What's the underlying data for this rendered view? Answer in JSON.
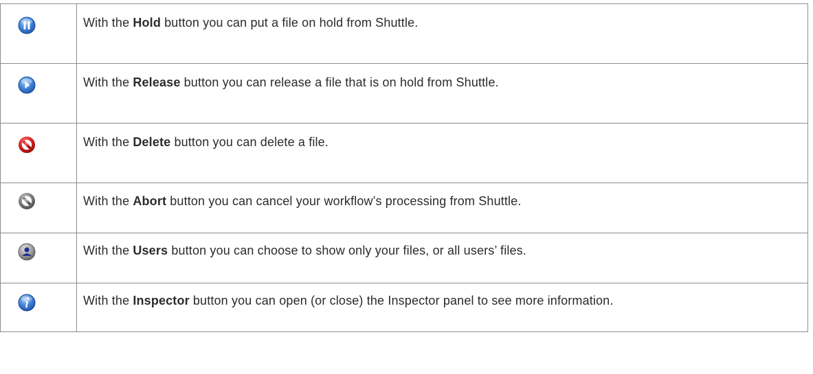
{
  "rows": [
    {
      "icon": "pause-icon",
      "prefix": "With the ",
      "keyword": "Hold",
      "suffix": " button you can put a file on hold from Shuttle."
    },
    {
      "icon": "play-icon",
      "prefix": "With the ",
      "keyword": "Release",
      "suffix": " button you can release a file that is on hold from Shuttle."
    },
    {
      "icon": "delete-no-entry-icon",
      "prefix": "With the ",
      "keyword": "Delete",
      "suffix": " button you can delete a file."
    },
    {
      "icon": "abort-no-entry-icon",
      "prefix": "With the ",
      "keyword": "Abort",
      "suffix": " button you can cancel your workflow’s processing from Shuttle."
    },
    {
      "icon": "users-icon",
      "prefix": "With the ",
      "keyword": "Users",
      "suffix": " button you can choose to show only your files, or all users’ files."
    },
    {
      "icon": "info-icon",
      "prefix": "With the ",
      "keyword": "Inspector",
      "suffix": " button you can open (or close) the Inspector panel to see more information."
    }
  ],
  "colors": {
    "border": "#8c8c8c",
    "text": "#2b2b2b",
    "pause_blue": "#2f6fc9",
    "delete_red": "#d41f1f",
    "abort_gray": "#7a7a7a",
    "info_blue": "#2a63c4"
  }
}
